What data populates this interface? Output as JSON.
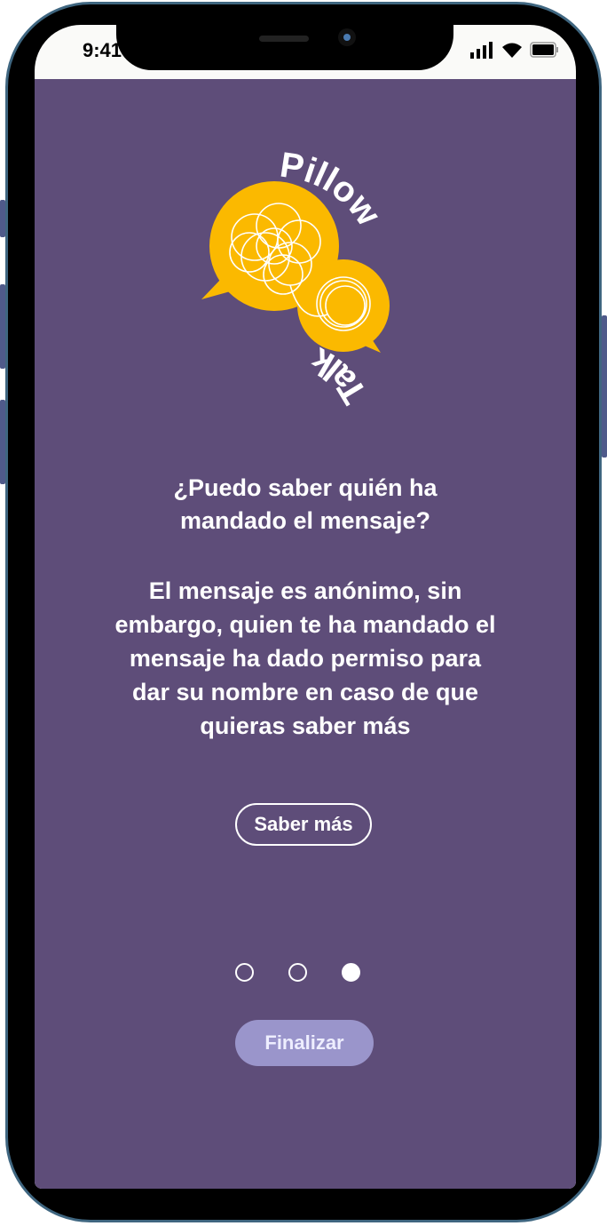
{
  "status": {
    "time": "9:41"
  },
  "logo": {
    "top": "Pillow",
    "bottom": "Talk"
  },
  "content": {
    "question": "¿Puedo saber quién ha mandado el mensaje?",
    "answer": "El mensaje es anónimo, sin embargo, quien te ha mandado el mensaje ha dado permiso para dar su nombre en caso de que quieras saber más"
  },
  "learn_more_label": "Saber más",
  "pagination": {
    "current": 3,
    "total": 3
  },
  "finish_label": "Finalizar",
  "colors": {
    "background": "#5e4d79",
    "accent": "#fbb900",
    "button": "#9a95cb"
  }
}
